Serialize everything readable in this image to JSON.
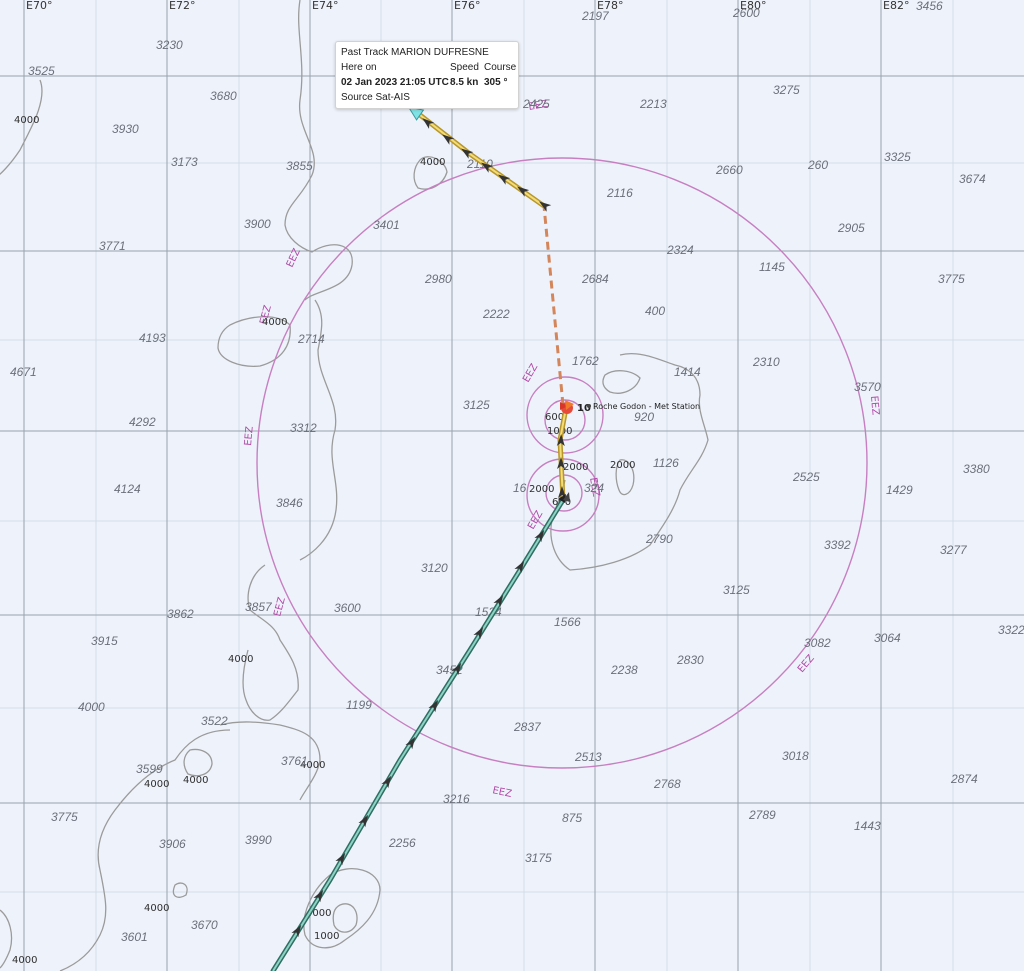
{
  "popup": {
    "title": "Past Track MARION DUFRESNE",
    "here_on_label": "Here on",
    "speed_label": "Speed",
    "course_label": "Course",
    "datetime": "02 Jan 2023 21:05 UTC",
    "speed_value": "8.5 kn",
    "course_value": "305 °",
    "source": "Source Sat-AIS"
  },
  "longitudes": [
    "E70°",
    "E72°",
    "E74°",
    "E76°",
    "E78°",
    "E80°",
    "E82°"
  ],
  "station_label": "Roche Godon - Met Station",
  "vessel_count": "10",
  "eez_label": "EEZ",
  "colors": {
    "track_recent": "#e8c84a",
    "track_old": "#5aa79a",
    "gap": "#d4855a",
    "eez": "#c77fc2",
    "sea": "#eef3fb"
  },
  "depth_soundings": [
    "3456",
    "2600",
    "2197",
    "3230",
    "3525",
    "3680",
    "3930",
    "3173",
    "3855",
    "2425",
    "2213",
    "3275",
    "3325",
    "3674",
    "2110",
    "2116",
    "2660",
    "260",
    "2905",
    "3900",
    "3401",
    "3771",
    "2980",
    "2684",
    "2324",
    "1145",
    "3775",
    "4193",
    "2714",
    "2222",
    "400",
    "4671",
    "1762",
    "1414",
    "2310",
    "3570",
    "3125",
    "4292",
    "3312",
    "920",
    "3380",
    "1126",
    "2525",
    "1429",
    "4124",
    "3846",
    "16",
    "324",
    "2790",
    "3392",
    "3277",
    "3120",
    "3862",
    "3857",
    "3600",
    "1524",
    "1566",
    "3125",
    "3322",
    "3915",
    "3082",
    "3064",
    "2238",
    "2830",
    "3452",
    "4000",
    "3522",
    "1199",
    "2837",
    "3599",
    "3761",
    "2513",
    "3018",
    "2874",
    "2768",
    "3216",
    "875",
    "2789",
    "1443",
    "3775",
    "3906",
    "3990",
    "2256",
    "3175",
    "3670",
    "3601"
  ],
  "contour_labels": [
    "4000",
    "2000",
    "1000",
    "600"
  ]
}
